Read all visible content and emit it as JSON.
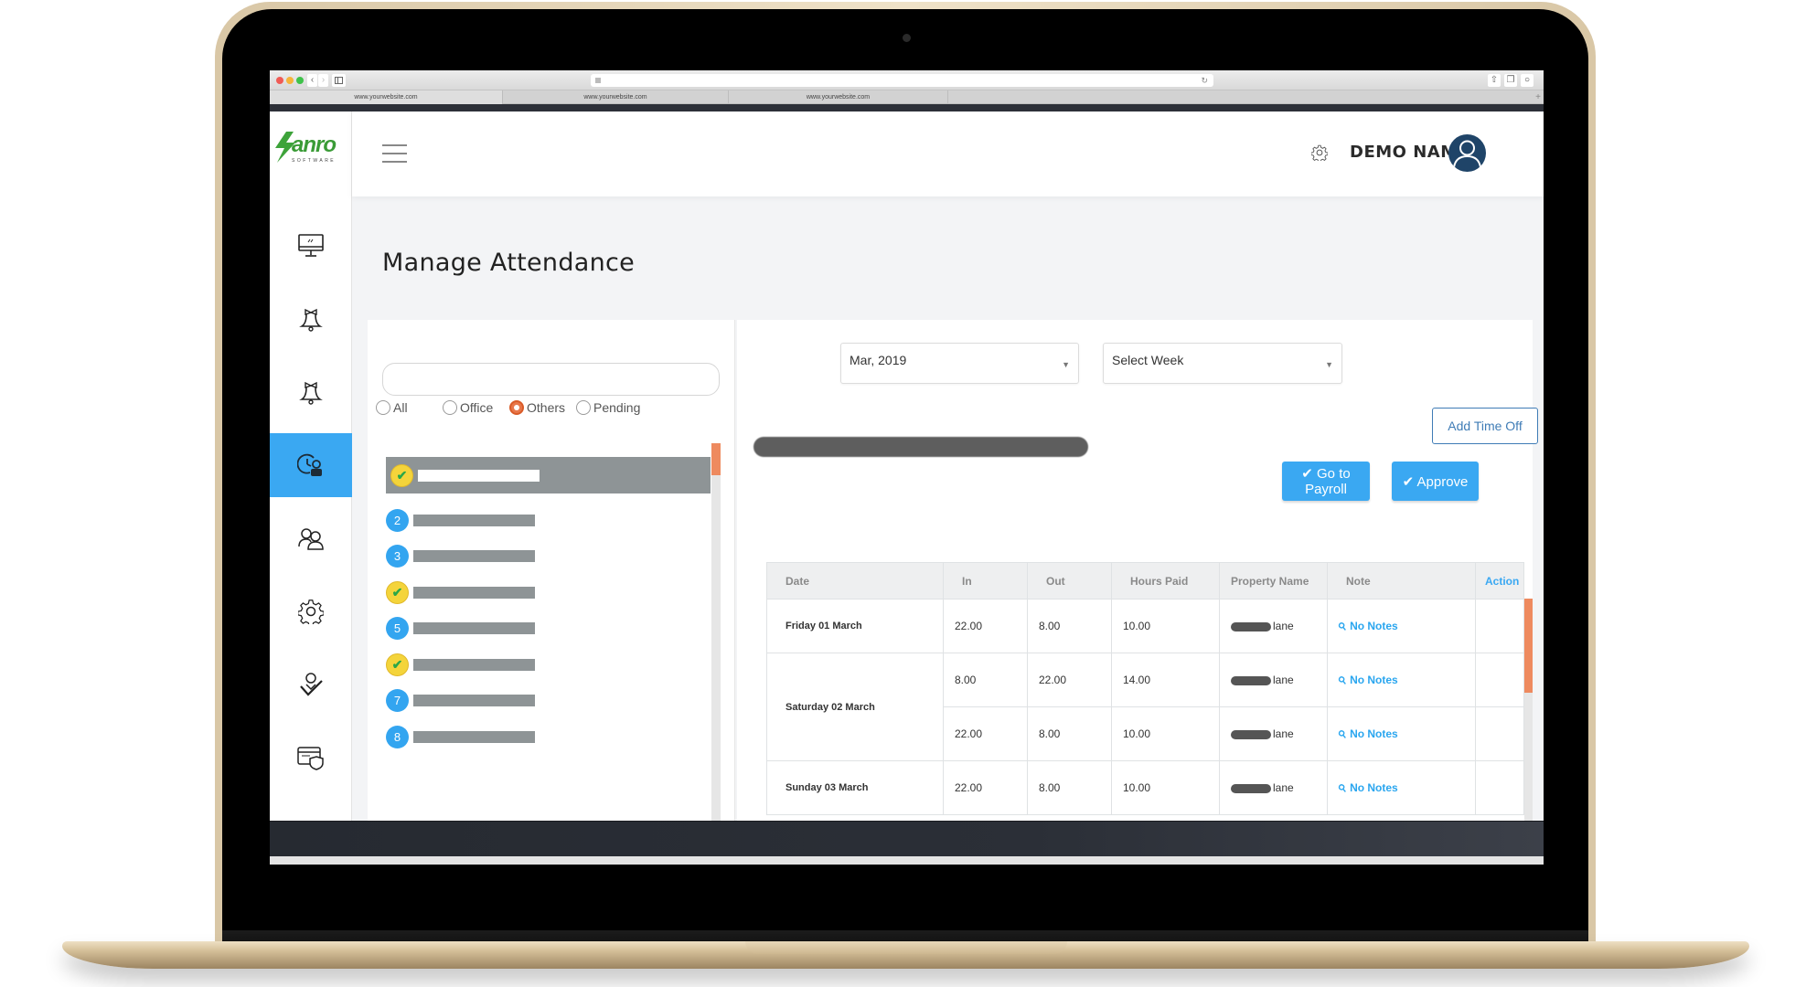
{
  "browser": {
    "tabs": [
      "www.yourwebsite.com",
      "www.yourwebsite.com",
      "www.yourwebsite.com"
    ],
    "close_tab_glyph": "×",
    "new_tab_glyph": "+",
    "back_glyph": "‹",
    "forward_glyph": "›"
  },
  "header": {
    "logo_text": "anro",
    "logo_subtext": "SOFTWARE",
    "user_name": "DEMO NAME"
  },
  "sidebar": {
    "items": [
      {
        "icon": "monitor-icon",
        "active": false
      },
      {
        "icon": "bell-icon",
        "active": false
      },
      {
        "icon": "bell-icon",
        "active": false
      },
      {
        "icon": "attendance-clock-user-icon",
        "active": true
      },
      {
        "icon": "users-icon",
        "active": false
      },
      {
        "icon": "gear-icon",
        "active": false
      },
      {
        "icon": "user-check-icon",
        "active": false
      },
      {
        "icon": "card-shield-icon",
        "active": false
      }
    ]
  },
  "page": {
    "title": "Manage Attendance"
  },
  "filters": {
    "search_value": "",
    "radios": [
      {
        "label": "All",
        "checked": false
      },
      {
        "label": "Office",
        "checked": false
      },
      {
        "label": "Others",
        "checked": true
      },
      {
        "label": "Pending",
        "checked": false
      }
    ]
  },
  "employees": [
    {
      "badge": "✔",
      "status": "done",
      "selected": true
    },
    {
      "badge": "2",
      "status": "num",
      "selected": false
    },
    {
      "badge": "3",
      "status": "num",
      "selected": false
    },
    {
      "badge": "✔",
      "status": "done",
      "selected": false
    },
    {
      "badge": "5",
      "status": "num",
      "selected": false
    },
    {
      "badge": "✔",
      "status": "done",
      "selected": false
    },
    {
      "badge": "7",
      "status": "num",
      "selected": false
    },
    {
      "badge": "8",
      "status": "num",
      "selected": false
    }
  ],
  "timesheet": {
    "month_select": "Mar, 2019",
    "week_select": "Select Week",
    "add_time_off_label": "Add Time Off",
    "go_to_payroll_label": "✔ Go to Payroll",
    "approve_label": "✔ Approve",
    "columns": [
      "Date",
      "In",
      "Out",
      "Hours Paid",
      "Property Name",
      "Note",
      "Action"
    ],
    "rows": [
      {
        "date": "Friday 01 March",
        "in": "22.00",
        "out": "8.00",
        "hours": "10.00",
        "property": "lane",
        "note": "No Notes",
        "rowspan": 1
      },
      {
        "date": "Saturday 02 March",
        "in": "8.00",
        "out": "22.00",
        "hours": "14.00",
        "property": "lane",
        "note": "No Notes",
        "rowspan": 2
      },
      {
        "date": "",
        "in": "22.00",
        "out": "8.00",
        "hours": "10.00",
        "property": "lane",
        "note": "No Notes",
        "rowspan": 0
      },
      {
        "date": "Sunday 03 March",
        "in": "22.00",
        "out": "8.00",
        "hours": "10.00",
        "property": "lane",
        "note": "No Notes",
        "rowspan": 1
      }
    ],
    "note_icon": "📎"
  },
  "colors": {
    "accent": "#3aa8f2",
    "radio_checked": "#e8774a",
    "scrollbar_thumb": "#ee8a5f",
    "badge_done": "#f4d43b",
    "check_green": "#2aa748",
    "avatar_bg": "#1f4468"
  }
}
